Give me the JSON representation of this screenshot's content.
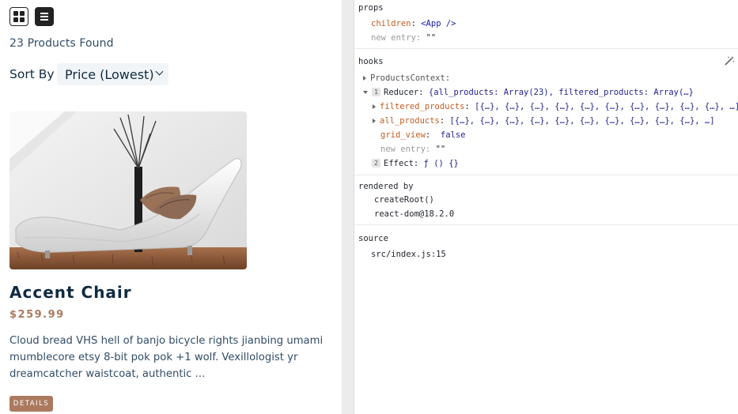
{
  "products_page": {
    "view_buttons": {
      "grid_icon": "grid-icon",
      "list_icon": "list-icon"
    },
    "products_found": "23 Products Found",
    "sort": {
      "label": "Sort By",
      "selected": "Price (Lowest)"
    },
    "product": {
      "name": "Accent Chair",
      "price": "$259.99",
      "description": "Cloud bread VHS hell of banjo bicycle rights jianbing umami mumblecore etsy 8-bit pok pok +1 wolf. Vexillologist yr dreamcatcher waistcoat, authentic ...",
      "details_label": "Details"
    }
  },
  "devtools": {
    "props": {
      "title": "props",
      "rows": [
        {
          "key": "children",
          "sep": ": ",
          "value": "<App />"
        },
        {
          "key": "new entry",
          "sep": ": ",
          "value": "\"\""
        }
      ]
    },
    "hooks": {
      "title": "hooks",
      "context_label": "ProductsContext:",
      "reducer": {
        "index": "1",
        "name": "Reducer:",
        "value": "{all_products: Array(23), filtered_products: Array(…}"
      },
      "filtered_products": {
        "key": "filtered_products",
        "value": "[{…}, {…}, {…}, {…}, {…}, {…}, {…}, {…}, {…}, {…}, …]"
      },
      "all_products": {
        "key": "all_products",
        "value": "[{…}, {…}, {…}, {…}, {…}, {…}, {…}, {…}, {…}, {…}, …]"
      },
      "grid_view": {
        "key": "grid_view",
        "value": "false"
      },
      "new_entry": {
        "key": "new entry",
        "value": "\"\""
      },
      "effect": {
        "index": "2",
        "name": "Effect:",
        "value": "ƒ () {}"
      }
    },
    "rendered_by": {
      "title": "rendered by",
      "items": [
        "createRoot()",
        "react-dom@18.2.0"
      ]
    },
    "source": {
      "title": "source",
      "path": "src/index.js:15"
    }
  },
  "colors": {
    "accent": "#ab7a5f",
    "heading": "#102a42",
    "body_text": "#324d67",
    "devtools_key": "#c15d23",
    "devtools_value": "#1f1f8f"
  }
}
